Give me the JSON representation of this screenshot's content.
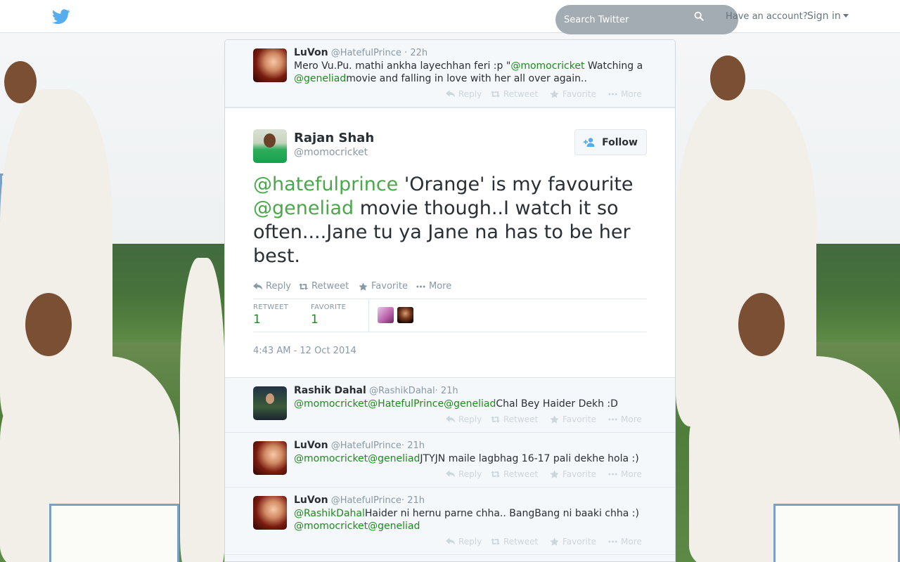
{
  "search": {
    "placeholder": "Search Twitter"
  },
  "header": {
    "have_account": "Have an account?",
    "sign_in": "Sign in"
  },
  "actions": {
    "reply": "Reply",
    "retweet": "Retweet",
    "favorite": "Favorite",
    "more": "More"
  },
  "tweets_above": [
    {
      "name": "LuVon",
      "handle": "@HatefulPrince",
      "time": "22h",
      "text_parts": [
        "Mero Vu.Pu. mathi ankha layechhan feri :p \"",
        "@momocricket",
        " Watching a ",
        "@geneliad",
        "movie and falling in love with her all over again.."
      ]
    }
  ],
  "focused": {
    "name": "Rajan Shah",
    "handle": "@momocricket",
    "follow_label": "Follow",
    "text_parts": [
      "@hatefulprince",
      " 'Orange' is my favourite ",
      "@geneliad",
      " movie though..I watch it so often....Jane tu ya Jane na has to be her best."
    ],
    "retweet_label": "RETWEET",
    "retweet_count": "1",
    "favorite_label": "FAVORITE",
    "favorite_count": "1",
    "date": "4:43 AM - 12 Oct 2014"
  },
  "replies": [
    {
      "name": "Rashik Dahal",
      "handle": "@RashikDahal",
      "time": "21h",
      "line1": [
        "@momocricket",
        "@HatefulPrince",
        "@geneliad",
        "Chal Bey Haider Dekh :D"
      ]
    },
    {
      "name": "LuVon",
      "handle": "@HatefulPrince",
      "time": "21h",
      "line1": [
        "@momocricket",
        "@geneliad",
        "JTYJN maile lagbhag 16-17 pali dekhe hola :)"
      ]
    },
    {
      "name": "LuVon",
      "handle": "@HatefulPrince",
      "time": "21h",
      "line1": [
        "@RashikDahal",
        "Haider ni hernu parne chha.. BangBang ni baaki chha :)"
      ],
      "line2": [
        "@momocricket",
        "@geneliad"
      ]
    }
  ],
  "icons": [
    "twitter-bird-icon",
    "search-icon",
    "caret-down-icon",
    "reply-icon",
    "retweet-icon",
    "star-icon",
    "more-dots-icon",
    "follow-user-icon"
  ],
  "colors": {
    "mention": "#1e8a1e",
    "brand": "#55acee",
    "text": "#292f33",
    "muted": "#8899a6"
  }
}
